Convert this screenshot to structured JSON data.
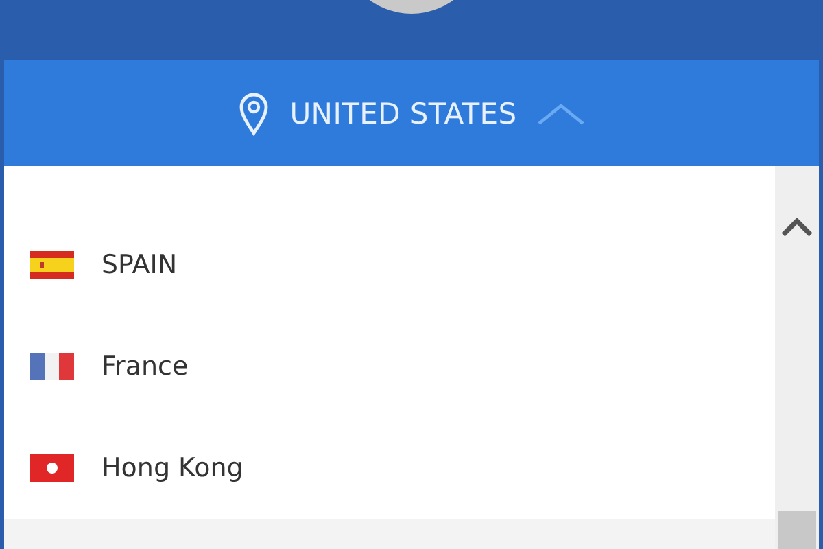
{
  "location_bar": {
    "country": "UNITED STATES",
    "expanded": true
  },
  "countries": [
    {
      "name": "SPAIN",
      "kind": "spain"
    },
    {
      "name": "France",
      "kind": "france"
    },
    {
      "name": "Hong Kong",
      "kind": "hongkong"
    }
  ]
}
